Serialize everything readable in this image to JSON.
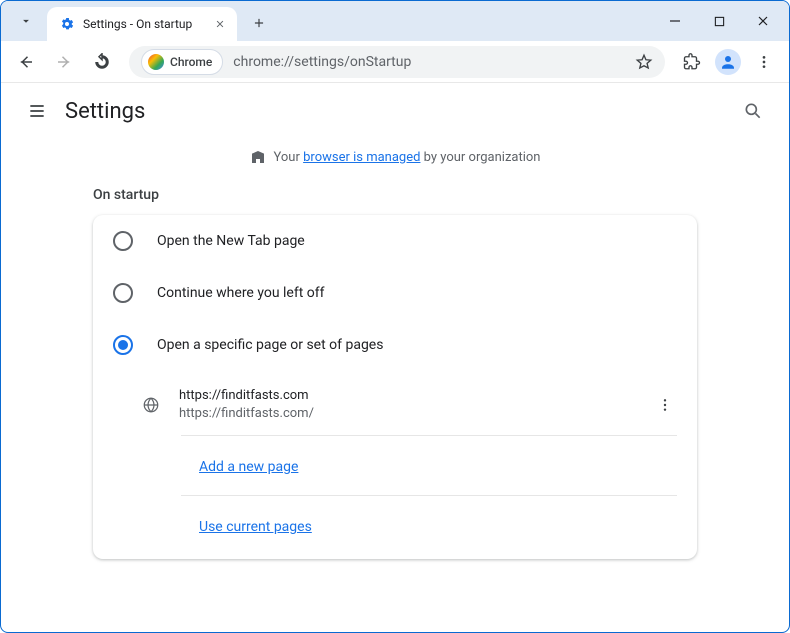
{
  "browser_tab": {
    "title": "Settings - On startup"
  },
  "omnibox": {
    "chip_label": "Chrome",
    "url": "chrome://settings/onStartup"
  },
  "settings": {
    "header_title": "Settings",
    "managed_prefix": "Your ",
    "managed_link": "browser is managed",
    "managed_suffix": " by your organization",
    "section_label": "On startup",
    "options": [
      {
        "label": "Open the New Tab page",
        "selected": false
      },
      {
        "label": "Continue where you left off",
        "selected": false
      },
      {
        "label": "Open a specific page or set of pages",
        "selected": true
      }
    ],
    "startup_page": {
      "title": "https://finditfasts.com",
      "url": "https://finditfasts.com/"
    },
    "add_page_label": "Add a new page",
    "use_current_label": "Use current pages"
  }
}
